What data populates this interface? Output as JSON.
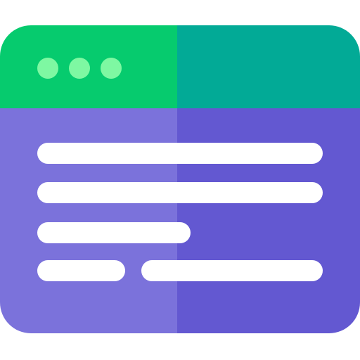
{
  "icon": {
    "name": "browser-window-icon",
    "colors": {
      "titlebar_left": "#06CB6E",
      "titlebar_right": "#02AA96",
      "body_left": "#7B72DB",
      "body_right": "#6358D1",
      "window_dots": "#7EF8A2",
      "text_lines": "#FFFFFF"
    },
    "window_dot_count": 3,
    "text_line_count": 5
  }
}
